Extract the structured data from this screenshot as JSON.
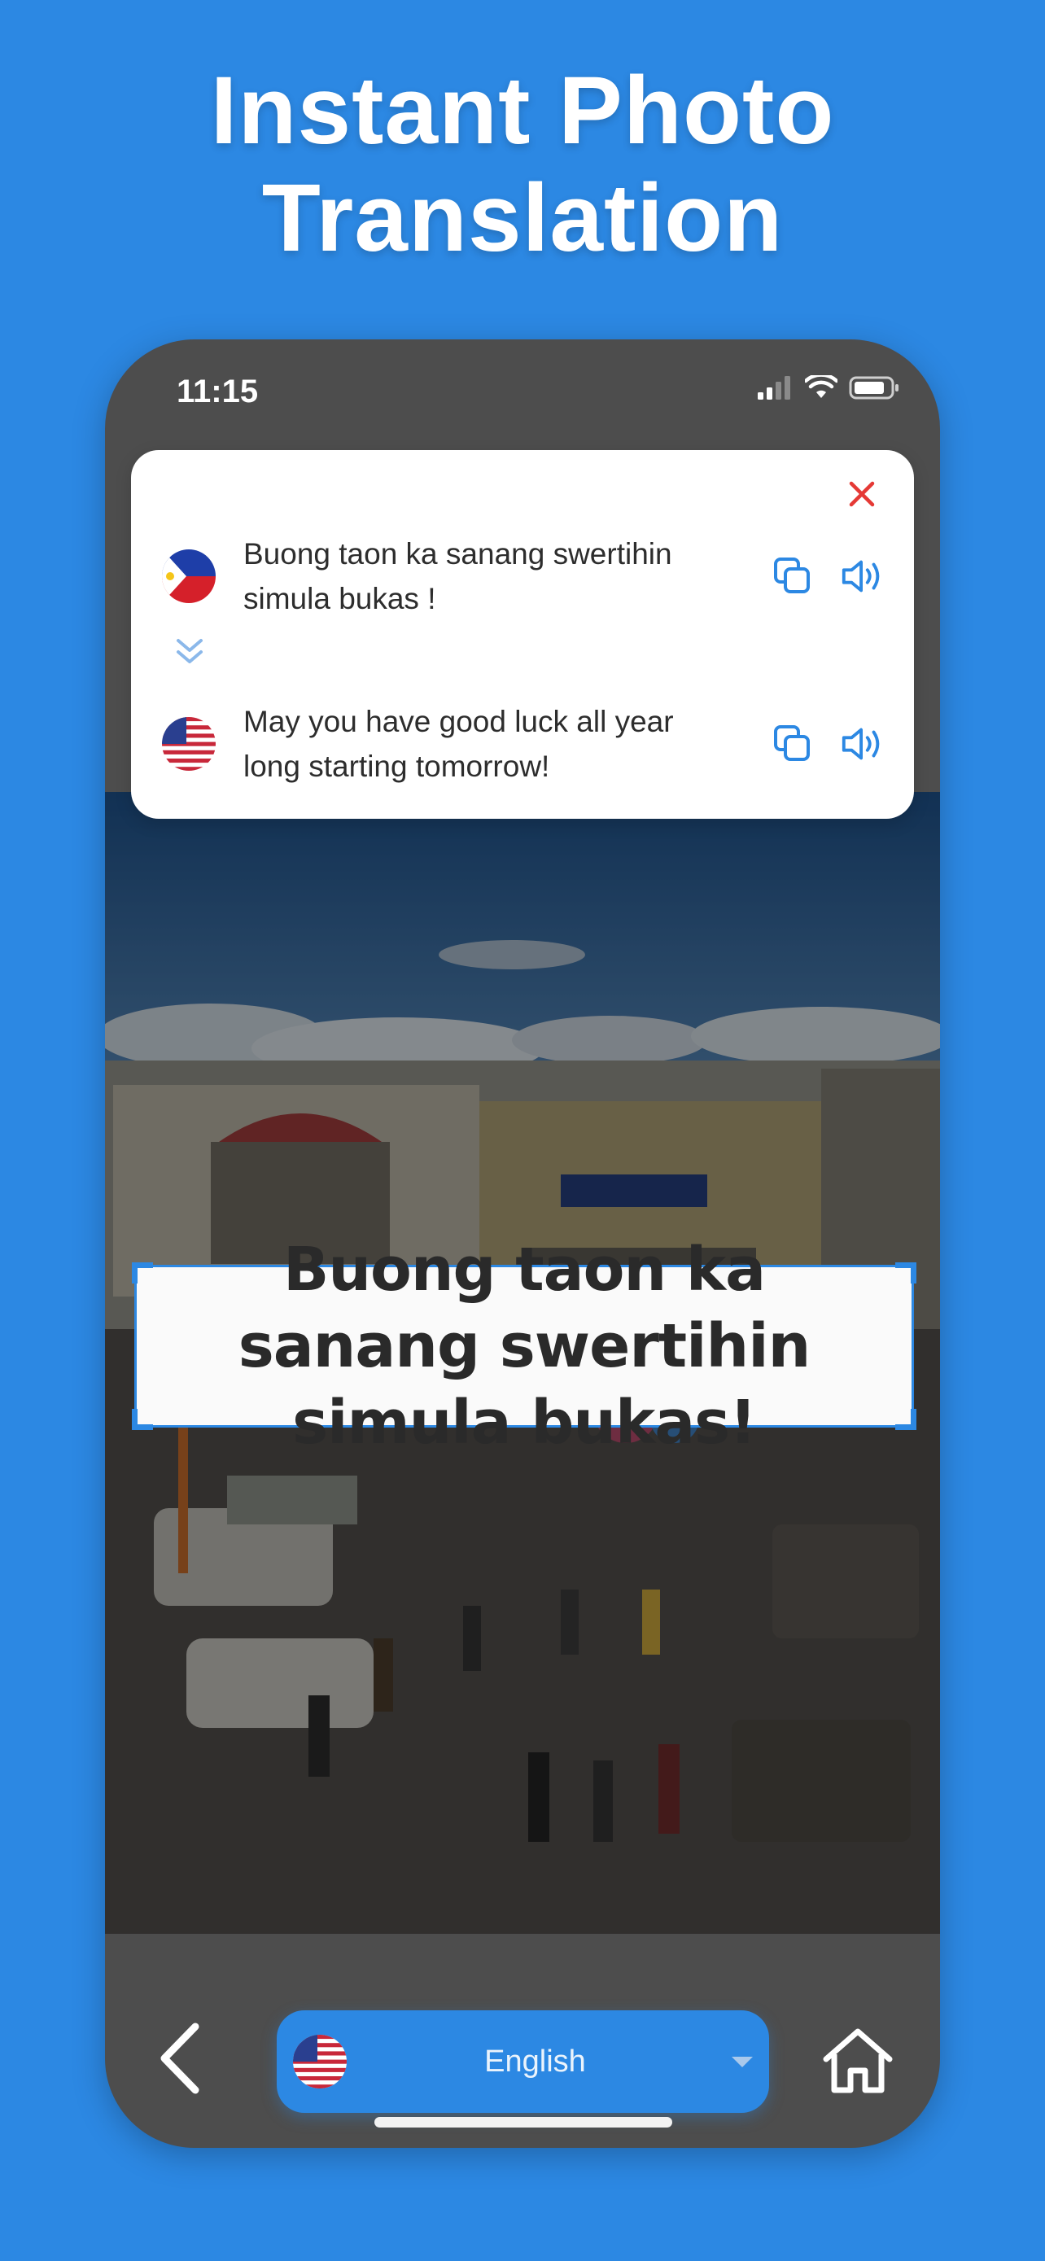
{
  "headline": {
    "line1": "Instant Photo",
    "line2": "Translation"
  },
  "status_bar": {
    "time": "11:15"
  },
  "translation_card": {
    "source": {
      "language_flag": "philippines-flag",
      "text": "Buong taon ka sanang swertihin simula bukas !"
    },
    "target": {
      "language_flag": "usa-flag",
      "text": "May you have good luck all year long starting tomorrow!"
    },
    "actions": {
      "copy_icon": "copy-icon",
      "speak_icon": "speaker-icon",
      "close_icon": "close-icon"
    }
  },
  "photo": {
    "detected_text": "Buong taon ka sanang swertihin simula bukas!"
  },
  "bottom_bar": {
    "language_select": {
      "flag": "usa-flag",
      "label": "English"
    },
    "back_icon": "chevron-left-icon",
    "home_icon": "home-icon"
  },
  "colors": {
    "accent": "#2c88e3",
    "close": "#e53935",
    "phone_bg": "#4d4d4d"
  }
}
